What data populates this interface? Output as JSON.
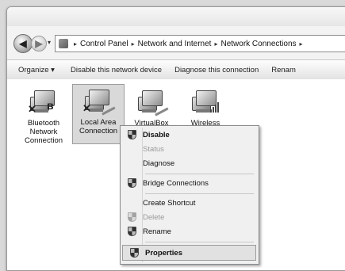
{
  "address_bar": {
    "segments": [
      "Control Panel",
      "Network and Internet",
      "Network Connections"
    ],
    "dropdown_glyph": "▾",
    "separator": "▸"
  },
  "toolbar": {
    "organize_label": "Organize ▾",
    "disable_label": "Disable this network device",
    "diagnose_label": "Diagnose this connection",
    "rename_label": "Renam"
  },
  "connections": [
    {
      "label_lines": [
        "Bluetooth",
        "Network",
        "Connection"
      ],
      "icon": "bluetooth-network-icon",
      "status": "disconnected"
    },
    {
      "label_lines": [
        "Local Area",
        "Connection"
      ],
      "icon": "ethernet-network-icon",
      "status": "disconnected",
      "selected": true
    },
    {
      "label_lines": [
        "VirtualBox"
      ],
      "icon": "ethernet-network-icon"
    },
    {
      "label_lines": [
        "Wireless"
      ],
      "icon": "wireless-network-icon"
    }
  ],
  "context_menu": {
    "items": [
      {
        "label": "Disable",
        "icon": "shield-icon",
        "enabled": true,
        "bold": true
      },
      {
        "label": "Status",
        "enabled": false
      },
      {
        "label": "Diagnose",
        "enabled": true
      },
      {
        "label": "Bridge Connections",
        "icon": "shield-icon",
        "enabled": true
      },
      {
        "label": "Create Shortcut",
        "enabled": true
      },
      {
        "label": "Delete",
        "icon": "shield-icon",
        "enabled": false
      },
      {
        "label": "Rename",
        "icon": "shield-icon",
        "enabled": true
      },
      {
        "label": "Properties",
        "icon": "shield-icon",
        "enabled": true,
        "highlighted": true
      }
    ]
  },
  "colors": {
    "window_bg": "#f3f3f3",
    "toolbar_bg": "#e3e3e3",
    "selection_bg": "#d9d9d9",
    "menu_bg": "#f0f0f0"
  }
}
